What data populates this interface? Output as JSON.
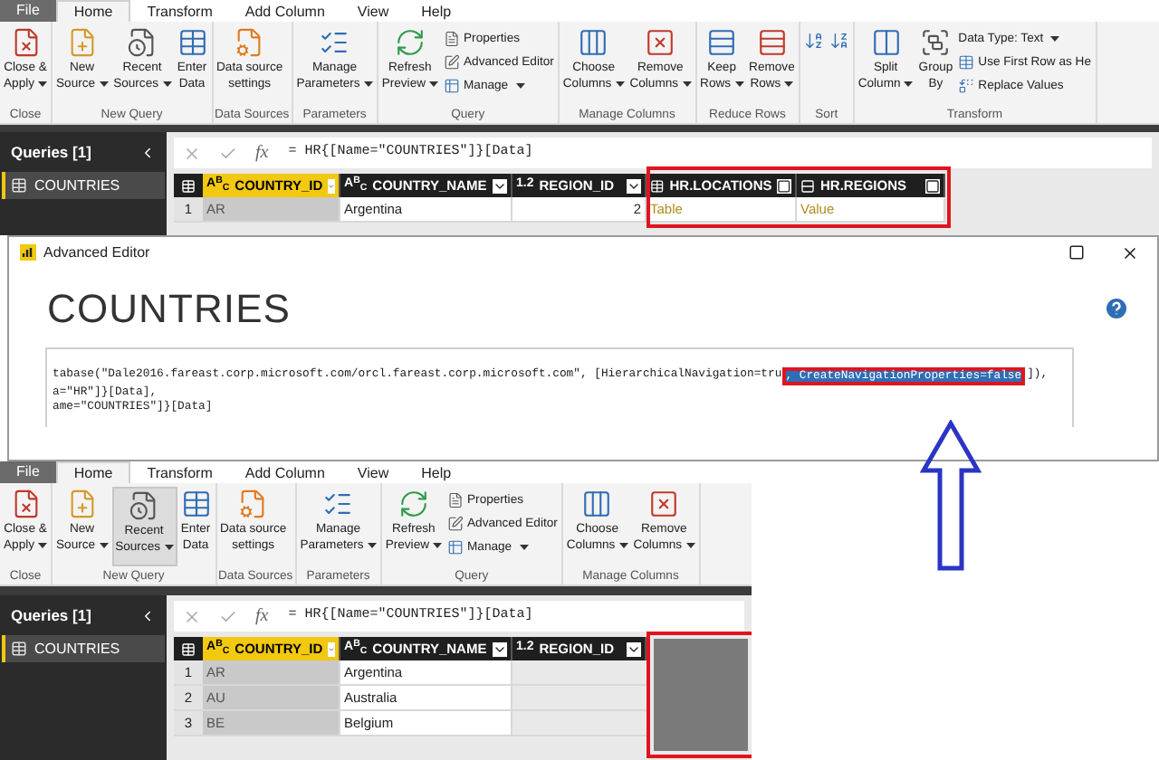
{
  "top_app": {
    "tabs": [
      {
        "label": "File",
        "kind": "file",
        "selected": false
      },
      {
        "label": "Home",
        "kind": "tab",
        "selected": true
      },
      {
        "label": "Transform",
        "kind": "tab",
        "selected": false
      },
      {
        "label": "Add Column",
        "kind": "tab",
        "selected": false
      },
      {
        "label": "View",
        "kind": "tab",
        "selected": false
      },
      {
        "label": "Help",
        "kind": "tab",
        "selected": false
      }
    ],
    "ribbon_groups": [
      {
        "label": "Close",
        "items": [
          {
            "kind": "large",
            "lines": [
              "Close &",
              "Apply"
            ],
            "dropdown": true,
            "selected": false
          }
        ]
      },
      {
        "label": "New Query",
        "items": [
          {
            "kind": "large",
            "lines": [
              "New",
              "Source"
            ],
            "dropdown": true,
            "selected": false
          },
          {
            "kind": "large",
            "lines": [
              "Recent",
              "Sources"
            ],
            "dropdown": true,
            "selected": false
          },
          {
            "kind": "large",
            "lines": [
              "Enter",
              "Data"
            ],
            "dropdown": false,
            "selected": false
          }
        ]
      },
      {
        "label": "Data Sources",
        "items": [
          {
            "kind": "large",
            "lines": [
              "Data source",
              "settings"
            ],
            "dropdown": false,
            "selected": false
          }
        ]
      },
      {
        "label": "Parameters",
        "items": [
          {
            "kind": "large",
            "lines": [
              "Manage",
              "Parameters"
            ],
            "dropdown": true,
            "selected": false
          }
        ]
      },
      {
        "label": "Query",
        "items": [
          {
            "kind": "large",
            "lines": [
              "Refresh",
              "Preview"
            ],
            "dropdown": true,
            "selected": false
          },
          {
            "kind": "small",
            "label": "Properties",
            "dropdown": false,
            "selected": false
          },
          {
            "kind": "small",
            "label": "Advanced Editor",
            "dropdown": false,
            "selected": false
          },
          {
            "kind": "small",
            "label": "Manage",
            "dropdown": true,
            "selected": false
          }
        ]
      },
      {
        "label": "Manage Columns",
        "items": [
          {
            "kind": "large",
            "lines": [
              "Choose",
              "Columns"
            ],
            "dropdown": true,
            "selected": false
          },
          {
            "kind": "large",
            "lines": [
              "Remove",
              "Columns"
            ],
            "dropdown": true,
            "selected": false
          }
        ]
      },
      {
        "label": "Reduce Rows",
        "items": [
          {
            "kind": "large",
            "lines": [
              "Keep",
              "Rows"
            ],
            "dropdown": true,
            "selected": false
          },
          {
            "kind": "large",
            "lines": [
              "Remove",
              "Rows"
            ],
            "dropdown": true,
            "selected": false
          }
        ]
      },
      {
        "label": "Sort",
        "items": [
          {
            "kind": "icon_only",
            "selected": false
          },
          {
            "kind": "icon_only",
            "selected": false
          }
        ]
      },
      {
        "label": "Transform",
        "items": [
          {
            "kind": "large",
            "lines": [
              "Split",
              "Column"
            ],
            "dropdown": true,
            "selected": false
          },
          {
            "kind": "large",
            "lines": [
              "Group",
              "By"
            ],
            "dropdown": false,
            "selected": false
          },
          {
            "kind": "small",
            "label": "Data Type: Text",
            "dropdown": true,
            "selected": false
          },
          {
            "kind": "small",
            "label": "Use First Row as He",
            "dropdown": false,
            "selected": false
          },
          {
            "kind": "small",
            "label": "Replace Values",
            "dropdown": false,
            "selected": false
          }
        ]
      }
    ],
    "queries": {
      "title": "Queries [1]",
      "items": [
        {
          "label": "COUNTRIES",
          "selected": true
        }
      ]
    },
    "formula_bar": {
      "symbol": "fx",
      "formula": "= HR{[Name=\"COUNTRIES\"]}[Data]"
    },
    "columns": [
      {
        "kind": "text",
        "type_label": "A$^{B}$$_{C}$",
        "name": "COUNTRY_ID",
        "selected": true
      },
      {
        "kind": "text",
        "type_label": "A$^{B}$$_{C}$",
        "name": "COUNTRY_NAME",
        "selected": false
      },
      {
        "kind": "number",
        "type_label": "1.2",
        "name": "REGION_ID",
        "selected": false
      },
      {
        "kind": "table",
        "name": "HR.LOCATIONS",
        "selected": false
      },
      {
        "kind": "record",
        "name": "HR.REGIONS",
        "selected": false
      }
    ],
    "rows": [
      {
        "number": "1",
        "cells": [
          "AR",
          "Argentina",
          "2",
          "Table",
          "Value"
        ]
      }
    ]
  },
  "editor": {
    "title": "Advanced Editor",
    "query_name": "COUNTRIES",
    "code_lines": [
      [
        {
          "text": "tabase(\"Dale2016.fareast.corp.microsoft.com/orcl.fareast.corp.microsoft.com\", [HierarchicalNavigation=tru",
          "selected": false
        },
        {
          "text": ", CreateNavigationProperties=false",
          "selected": true
        },
        {
          "text": "]),",
          "selected": false
        }
      ],
      [
        {
          "text": "a=\"HR\"]}[Data],",
          "selected": false
        }
      ],
      [
        {
          "text": "ame=\"COUNTRIES\"]}[Data]",
          "selected": false
        }
      ]
    ]
  },
  "bottom_app": {
    "tabs": [
      {
        "label": "File",
        "kind": "file",
        "selected": false
      },
      {
        "label": "Home",
        "kind": "tab",
        "selected": true
      },
      {
        "label": "Transform",
        "kind": "tab",
        "selected": false
      },
      {
        "label": "Add Column",
        "kind": "tab",
        "selected": false
      },
      {
        "label": "View",
        "kind": "tab",
        "selected": false
      },
      {
        "label": "Help",
        "kind": "tab",
        "selected": false
      }
    ],
    "ribbon_groups": [
      {
        "label": "Close",
        "items": [
          {
            "kind": "large",
            "lines": [
              "Close &",
              "Apply"
            ],
            "dropdown": true,
            "selected": false
          }
        ]
      },
      {
        "label": "New Query",
        "items": [
          {
            "kind": "large",
            "lines": [
              "New",
              "Source"
            ],
            "dropdown": true,
            "selected": false
          },
          {
            "kind": "large",
            "lines": [
              "Recent",
              "Sources"
            ],
            "dropdown": true,
            "selected": true
          },
          {
            "kind": "large",
            "lines": [
              "Enter",
              "Data"
            ],
            "dropdown": false,
            "selected": false
          }
        ]
      },
      {
        "label": "Data Sources",
        "items": [
          {
            "kind": "large",
            "lines": [
              "Data source",
              "settings"
            ],
            "dropdown": false,
            "selected": false
          }
        ]
      },
      {
        "label": "Parameters",
        "items": [
          {
            "kind": "large",
            "lines": [
              "Manage",
              "Parameters"
            ],
            "dropdown": true,
            "selected": false
          }
        ]
      },
      {
        "label": "Query",
        "items": [
          {
            "kind": "large",
            "lines": [
              "Refresh",
              "Preview"
            ],
            "dropdown": true,
            "selected": false
          },
          {
            "kind": "small",
            "label": "Properties",
            "dropdown": false,
            "selected": false
          },
          {
            "kind": "small",
            "label": "Advanced Editor",
            "dropdown": false,
            "selected": false
          },
          {
            "kind": "small",
            "label": "Manage",
            "dropdown": true,
            "selected": false
          }
        ]
      },
      {
        "label": "Manage Columns",
        "items": [
          {
            "kind": "large",
            "lines": [
              "Choose",
              "Columns"
            ],
            "dropdown": true,
            "selected": false
          },
          {
            "kind": "large",
            "lines": [
              "Remove",
              "Columns"
            ],
            "dropdown": true,
            "selected": false
          }
        ]
      }
    ],
    "queries": {
      "title": "Queries [1]",
      "items": [
        {
          "label": "COUNTRIES",
          "selected": true
        }
      ]
    },
    "formula_bar": {
      "symbol": "fx",
      "formula": "= HR{[Name=\"COUNTRIES\"]}[Data]"
    },
    "columns": [
      {
        "kind": "text",
        "type_label": "A$^{B}$$_{C}$",
        "name": "COUNTRY_ID",
        "selected": true
      },
      {
        "kind": "text",
        "type_label": "A$^{B}$$_{C}$",
        "name": "COUNTRY_NAME",
        "selected": false
      },
      {
        "kind": "number",
        "type_label": "1.2",
        "name": "REGION_ID",
        "selected": false
      }
    ],
    "rows": [
      {
        "number": "1",
        "cells": [
          "AR",
          "Argentina"
        ]
      },
      {
        "number": "2",
        "cells": [
          "AU",
          "Australia"
        ]
      },
      {
        "number": "3",
        "cells": [
          "BE",
          "Belgium"
        ]
      }
    ]
  }
}
